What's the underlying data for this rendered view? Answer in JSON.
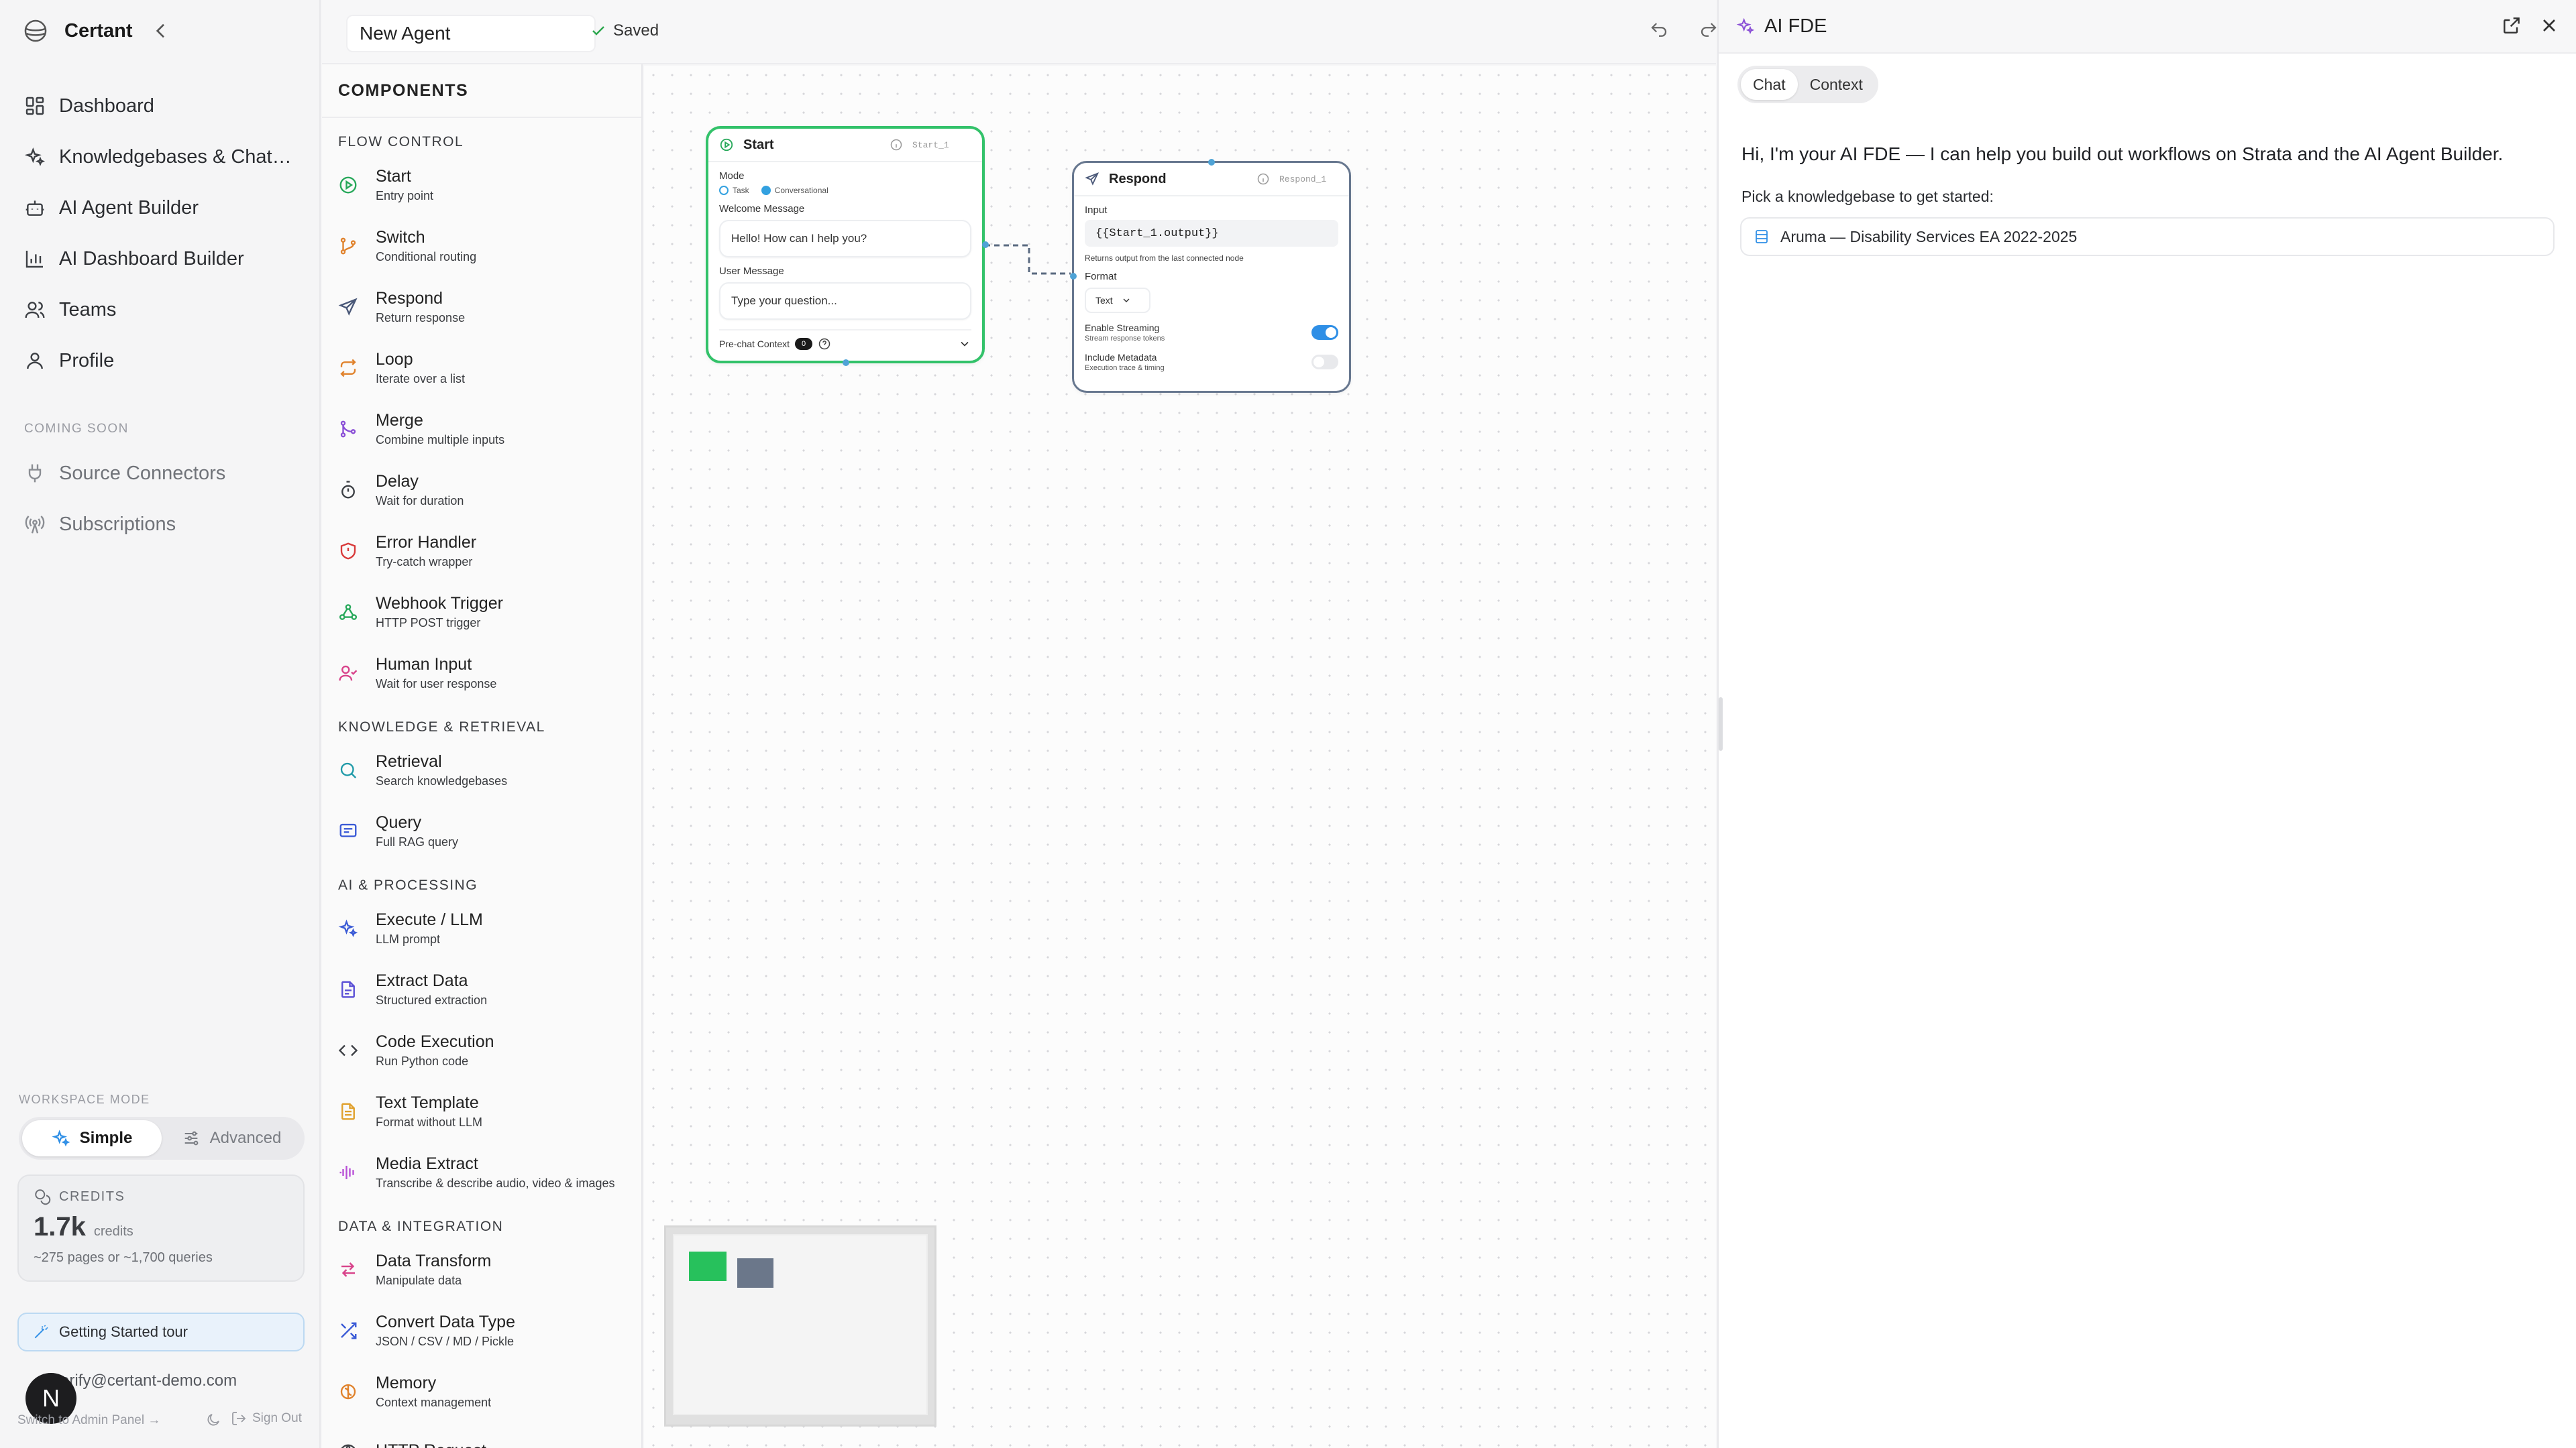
{
  "sidebar": {
    "brand": "Certant",
    "nav": [
      {
        "label": "Dashboard",
        "icon": "dashboard-icon"
      },
      {
        "label": "Knowledgebases & Chatbots",
        "icon": "sparkles-icon"
      },
      {
        "label": "AI Agent Builder",
        "icon": "bot-icon"
      },
      {
        "label": "AI Dashboard Builder",
        "icon": "bar-chart-icon"
      },
      {
        "label": "Teams",
        "icon": "users-icon"
      },
      {
        "label": "Profile",
        "icon": "user-icon"
      }
    ],
    "coming_soon_label": "COMING SOON",
    "coming_soon": [
      {
        "label": "Source Connectors",
        "icon": "plug-icon"
      },
      {
        "label": "Subscriptions",
        "icon": "radio-tower-icon"
      }
    ],
    "workspace_mode_label": "WORKSPACE MODE",
    "mode_simple": "Simple",
    "mode_advanced": "Advanced",
    "credits_label": "CREDITS",
    "credits_amount": "1.7k",
    "credits_unit": "credits",
    "credits_detail": "~275 pages or ~1,700 queries",
    "tour_label": "Getting Started tour",
    "user_email": "verify@certant-demo.com",
    "avatar_letter": "N",
    "admin_link": "Switch to Admin Panel →",
    "signout": "Sign Out"
  },
  "topbar": {
    "agent_name": "New Agent",
    "saved_label": "Saved"
  },
  "components": {
    "title": "COMPONENTS",
    "sections": [
      {
        "title": "FLOW CONTROL",
        "items": [
          {
            "name": "Start",
            "desc": "Entry point",
            "icon": "play-circle-icon",
            "color": "#27a85a"
          },
          {
            "name": "Switch",
            "desc": "Conditional routing",
            "icon": "git-branch-icon",
            "color": "#e0822c"
          },
          {
            "name": "Respond",
            "desc": "Return response",
            "icon": "send-icon",
            "color": "#4a5878"
          },
          {
            "name": "Loop",
            "desc": "Iterate over a list",
            "icon": "repeat-icon",
            "color": "#e0822c"
          },
          {
            "name": "Merge",
            "desc": "Combine multiple inputs",
            "icon": "git-merge-icon",
            "color": "#8a4fd6"
          },
          {
            "name": "Delay",
            "desc": "Wait for duration",
            "icon": "timer-icon",
            "color": "#3c3f44"
          },
          {
            "name": "Error Handler",
            "desc": "Try-catch wrapper",
            "icon": "shield-alert-icon",
            "color": "#d83a3a"
          },
          {
            "name": "Webhook Trigger",
            "desc": "HTTP POST trigger",
            "icon": "webhook-icon",
            "color": "#27a85a"
          },
          {
            "name": "Human Input",
            "desc": "Wait for user response",
            "icon": "user-check-icon",
            "color": "#d8428a"
          }
        ]
      },
      {
        "title": "KNOWLEDGE & RETRIEVAL",
        "items": [
          {
            "name": "Retrieval",
            "desc": "Search knowledgebases",
            "icon": "search-icon",
            "color": "#1f9aa8"
          },
          {
            "name": "Query",
            "desc": "Full RAG query",
            "icon": "message-square-icon",
            "color": "#3b5bd6"
          }
        ]
      },
      {
        "title": "AI & PROCESSING",
        "items": [
          {
            "name": "Execute / LLM",
            "desc": "LLM prompt",
            "icon": "sparkles-icon",
            "color": "#3b5bd6"
          },
          {
            "name": "Extract Data",
            "desc": "Structured extraction",
            "icon": "file-text-icon",
            "color": "#5a4fd6"
          },
          {
            "name": "Code Execution",
            "desc": "Run Python code",
            "icon": "code-icon",
            "color": "#3c3f44"
          },
          {
            "name": "Text Template",
            "desc": "Format without LLM",
            "icon": "file-icon",
            "color": "#e0a02c"
          },
          {
            "name": "Media Extract",
            "desc": "Transcribe & describe audio, video & images",
            "icon": "audio-waveform-icon",
            "color": "#b84fd6"
          }
        ]
      },
      {
        "title": "DATA & INTEGRATION",
        "items": [
          {
            "name": "Data Transform",
            "desc": "Manipulate data",
            "icon": "arrows-swap-icon",
            "color": "#d8428a"
          },
          {
            "name": "Convert Data Type",
            "desc": "JSON / CSV / MD / Pickle",
            "icon": "shuffle-icon",
            "color": "#3b5bd6"
          },
          {
            "name": "Memory",
            "desc": "Context management",
            "icon": "brain-icon",
            "color": "#e0822c"
          },
          {
            "name": "HTTP Request",
            "desc": "",
            "icon": "globe-icon",
            "color": "#3c3f44"
          }
        ]
      }
    ]
  },
  "start_node": {
    "title": "Start",
    "id": "Start_1",
    "mode_label": "Mode",
    "mode_task": "Task",
    "mode_conversational": "Conversational",
    "welcome_label": "Welcome Message",
    "welcome_value": "Hello! How can I help you?",
    "user_label": "User Message",
    "user_placeholder": "Type your question...",
    "prechat_label": "Pre-chat Context",
    "prechat_count": "0"
  },
  "respond_node": {
    "title": "Respond",
    "id": "Respond_1",
    "input_label": "Input",
    "input_value": "{{Start_1.output}}",
    "input_hint": "Returns output from the last connected node",
    "format_label": "Format",
    "format_value": "Text",
    "streaming_label": "Enable Streaming",
    "streaming_desc": "Stream response tokens",
    "metadata_label": "Include Metadata",
    "metadata_desc": "Execution trace & timing"
  },
  "ai_panel": {
    "title": "AI FDE",
    "tab_chat": "Chat",
    "tab_context": "Context",
    "message": "Hi, I'm your AI FDE — I can help you build out workflows on Strata and the AI Agent Builder.",
    "pick_label": "Pick a knowledgebase to get started:",
    "kb_option": "Aruma — Disability Services EA 2022-2025"
  },
  "colors": {
    "accent": "#2f8fe6",
    "start_border": "#33c26a",
    "respond_border": "#67778f"
  }
}
